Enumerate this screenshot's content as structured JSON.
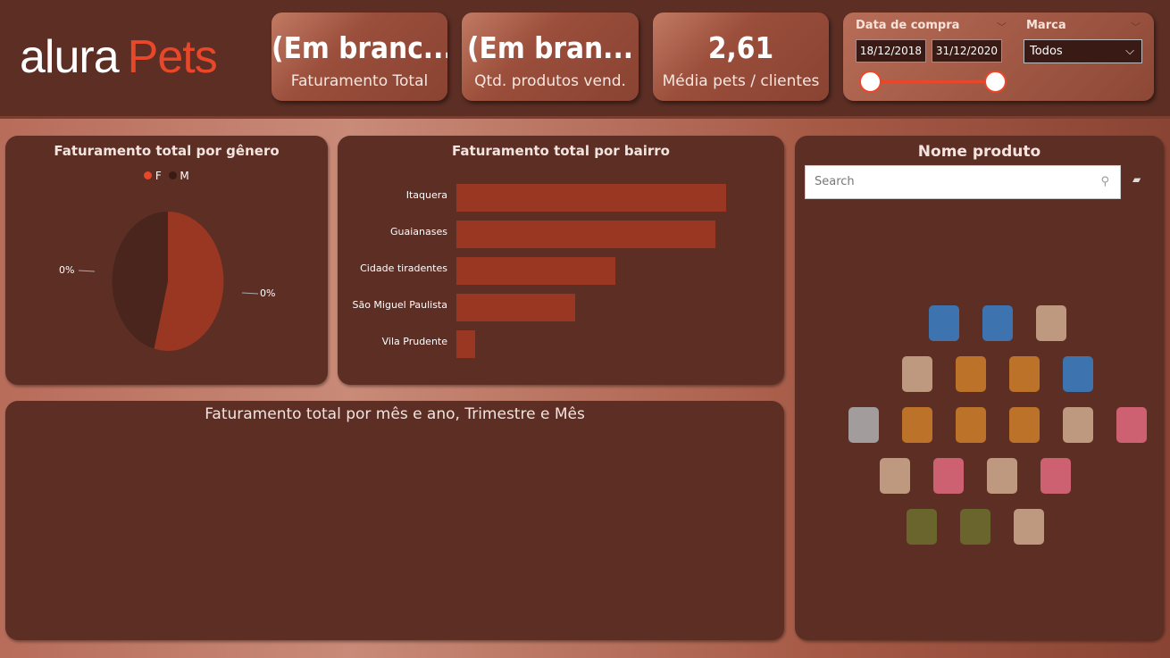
{
  "logo": {
    "text_a": "alura",
    "text_b": "Pets"
  },
  "cards": [
    {
      "value": "(Em branc...",
      "label": "Faturamento Total"
    },
    {
      "value": "(Em bran...",
      "label": "Qtd. produtos vend."
    },
    {
      "value": "2,61",
      "label": "Média pets / clientes"
    }
  ],
  "filters": {
    "date": {
      "label": "Data de compra",
      "start": "18/12/2018",
      "end": "31/12/2020"
    },
    "brand": {
      "label": "Marca",
      "value": "Todos"
    }
  },
  "pie": {
    "title": "Faturamento total por gênero",
    "legend": [
      "F",
      "M"
    ],
    "colors": [
      "#9a3722",
      "#4a251d"
    ],
    "legend_colors": [
      "#e8472a",
      "#3a1a14"
    ],
    "chart_data": {
      "type": "pie",
      "categories": [
        "F",
        "M"
      ],
      "values": [
        54,
        46
      ],
      "data_labels": [
        "0%",
        "0%"
      ]
    }
  },
  "bar": {
    "title": "Faturamento total por bairro",
    "color": "#9a3722",
    "chart_data": {
      "type": "bar",
      "orientation": "horizontal",
      "categories": [
        "Itaquera",
        "Guaianases",
        "Cidade tiradentes",
        "São Miguel Paulista",
        "Vila Prudente"
      ],
      "values": [
        100,
        96,
        59,
        44,
        7
      ]
    }
  },
  "timeline": {
    "title": "Faturamento total por mês e ano, Trimestre e Mês"
  },
  "products": {
    "title": "Nome produto",
    "search_placeholder": "Search",
    "icons": [
      "cat-food-bag-blue",
      "dog-food-bag-blue",
      "pet-food-bag",
      "pet-food-bag",
      "dog-toy",
      "collar-tag",
      "cat-food-bag-blue",
      "mouse-toy",
      "dog-collar",
      "ball-toy",
      "collar-red",
      "pet-food-bag",
      "pet-coat-pink",
      "bone-toy",
      "treat-package-pink",
      "canned-food",
      "pet-coat-pink",
      "pet-vest-green",
      "pet-vest-green",
      "fishing-toy"
    ]
  }
}
